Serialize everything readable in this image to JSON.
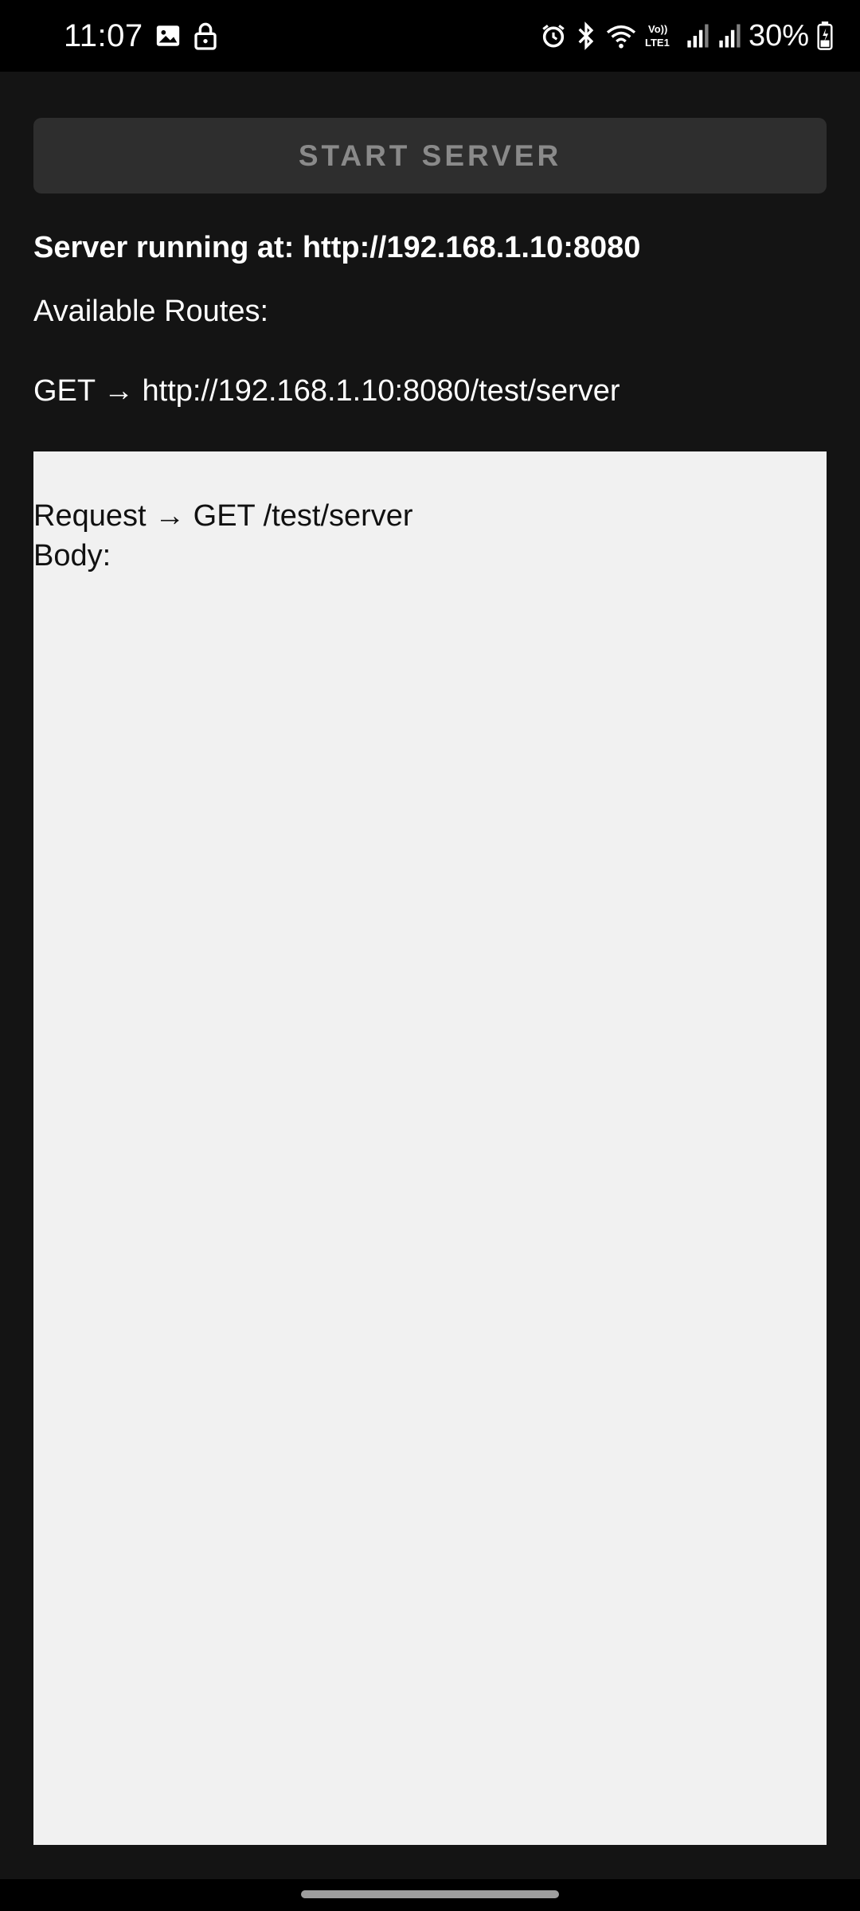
{
  "status_bar": {
    "time": "11:07",
    "battery_percent": "30%",
    "network_label": "Vo)) LTE1",
    "left_icons": [
      "image-icon",
      "lock-icon"
    ],
    "right_icons": [
      "alarm-icon",
      "bluetooth-icon",
      "wifi-icon",
      "volte-icon",
      "signal-icon",
      "signal-icon",
      "battery-charging-icon"
    ]
  },
  "toolbar": {
    "start_button_label": "START SERVER"
  },
  "server": {
    "status_text": "Server running at: http://192.168.1.10:8080",
    "routes_heading": "Available Routes:",
    "routes": [
      "GET → http://192.168.1.10:8080/test/server"
    ]
  },
  "log": {
    "lines": [
      "Request → GET /test/server",
      "Body:"
    ]
  },
  "colors": {
    "background": "#141414",
    "status_bar": "#000000",
    "button_bg": "#2e2e2e",
    "button_text": "#8a8a8a",
    "log_bg": "#f1f1f1",
    "text_primary": "#ffffff"
  }
}
